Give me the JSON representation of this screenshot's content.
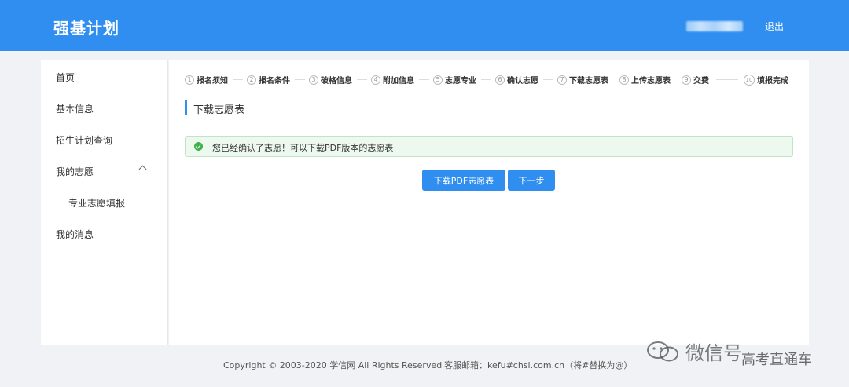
{
  "header": {
    "brand": "强基计划",
    "logout_label": "退出"
  },
  "sidebar": {
    "items": [
      {
        "label": "首页"
      },
      {
        "label": "基本信息"
      },
      {
        "label": "招生计划查询"
      },
      {
        "label": "我的志愿"
      },
      {
        "label": "专业志愿填报"
      },
      {
        "label": "我的消息"
      }
    ]
  },
  "steps": [
    {
      "num": "1",
      "label": "报名须知"
    },
    {
      "num": "2",
      "label": "报名条件"
    },
    {
      "num": "3",
      "label": "破格信息"
    },
    {
      "num": "4",
      "label": "附加信息"
    },
    {
      "num": "5",
      "label": "志愿专业"
    },
    {
      "num": "6",
      "label": "确认志愿"
    },
    {
      "num": "7",
      "label": "下载志愿表"
    },
    {
      "num": "8",
      "label": "上传志愿表"
    },
    {
      "num": "9",
      "label": "交费"
    },
    {
      "num": "10",
      "label": "填报完成"
    }
  ],
  "main": {
    "section_title": "下载志愿表",
    "alert_text": "您已经确认了志愿！可以下载PDF版本的志愿表",
    "download_button": "下载PDF志愿表",
    "next_button": "下一步"
  },
  "footer": {
    "copyright": "Copyright © 2003-2020 学信网 All Rights Reserved",
    "email": "客服邮箱：kefu#chsi.com.cn（将#替换为@）"
  },
  "watermark": {
    "wechat": "微信号",
    "account": "高考直通车"
  },
  "colors": {
    "primary": "#2f8ef0",
    "success": "#3cb34b",
    "alert_bg": "#edf9ef"
  }
}
